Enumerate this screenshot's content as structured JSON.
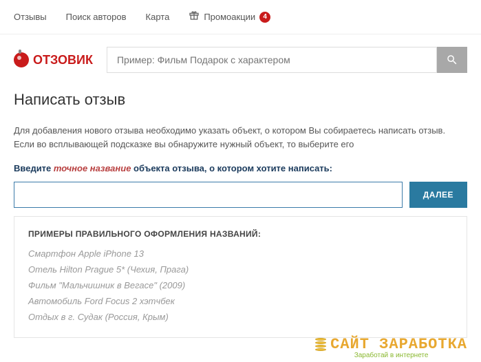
{
  "nav": {
    "reviews": "Отзывы",
    "authors": "Поиск авторов",
    "map": "Карта",
    "promo": "Промоакции",
    "promo_count": "4"
  },
  "logo": "ОТЗОВИК",
  "search": {
    "placeholder": "Пример: Фильм Подарок с характером"
  },
  "page": {
    "title": "Написать отзыв",
    "desc": "Для добавления нового отзыва необходимо указать объект, о котором Вы собираетесь написать отзыв. Если во всплывающей подсказке вы обнаружите нужный объект, то выберите его",
    "prompt_before": "Введите ",
    "prompt_highlight": "точное название",
    "prompt_after": " объекта отзыва, о котором хотите написать:",
    "input_value": "",
    "next_label": "ДАЛЕЕ"
  },
  "examples": {
    "title": "ПРИМЕРЫ ПРАВИЛЬНОГО ОФОРМЛЕНИЯ НАЗВАНИЙ:",
    "items": [
      "Смартфон Apple iPhone 13",
      "Отель Hilton Prague 5* (Чехия, Прага)",
      "Фильм \"Мальчишник в Вегасе\" (2009)",
      "Автомобиль Ford Focus 2 хэтчбек",
      "Отдых в г. Судак (Россия, Крым)"
    ]
  },
  "watermark": {
    "title": "САЙТ ЗАРАБОТКА",
    "sub": "Заработай в интернете"
  }
}
